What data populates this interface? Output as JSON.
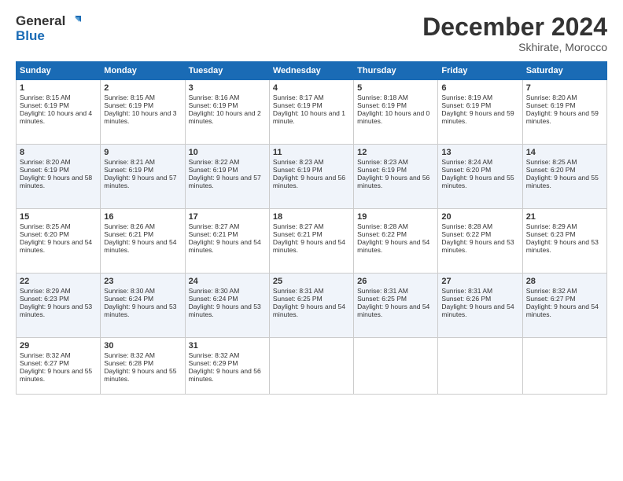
{
  "logo": {
    "line1": "General",
    "line2": "Blue"
  },
  "title": "December 2024",
  "location": "Skhirate, Morocco",
  "days_of_week": [
    "Sunday",
    "Monday",
    "Tuesday",
    "Wednesday",
    "Thursday",
    "Friday",
    "Saturday"
  ],
  "weeks": [
    [
      {
        "day": "1",
        "sunrise": "8:15 AM",
        "sunset": "6:19 PM",
        "daylight": "10 hours and 4 minutes."
      },
      {
        "day": "2",
        "sunrise": "8:15 AM",
        "sunset": "6:19 PM",
        "daylight": "10 hours and 3 minutes."
      },
      {
        "day": "3",
        "sunrise": "8:16 AM",
        "sunset": "6:19 PM",
        "daylight": "10 hours and 2 minutes."
      },
      {
        "day": "4",
        "sunrise": "8:17 AM",
        "sunset": "6:19 PM",
        "daylight": "10 hours and 1 minute."
      },
      {
        "day": "5",
        "sunrise": "8:18 AM",
        "sunset": "6:19 PM",
        "daylight": "10 hours and 0 minutes."
      },
      {
        "day": "6",
        "sunrise": "8:19 AM",
        "sunset": "6:19 PM",
        "daylight": "9 hours and 59 minutes."
      },
      {
        "day": "7",
        "sunrise": "8:20 AM",
        "sunset": "6:19 PM",
        "daylight": "9 hours and 59 minutes."
      }
    ],
    [
      {
        "day": "8",
        "sunrise": "8:20 AM",
        "sunset": "6:19 PM",
        "daylight": "9 hours and 58 minutes."
      },
      {
        "day": "9",
        "sunrise": "8:21 AM",
        "sunset": "6:19 PM",
        "daylight": "9 hours and 57 minutes."
      },
      {
        "day": "10",
        "sunrise": "8:22 AM",
        "sunset": "6:19 PM",
        "daylight": "9 hours and 57 minutes."
      },
      {
        "day": "11",
        "sunrise": "8:23 AM",
        "sunset": "6:19 PM",
        "daylight": "9 hours and 56 minutes."
      },
      {
        "day": "12",
        "sunrise": "8:23 AM",
        "sunset": "6:19 PM",
        "daylight": "9 hours and 56 minutes."
      },
      {
        "day": "13",
        "sunrise": "8:24 AM",
        "sunset": "6:20 PM",
        "daylight": "9 hours and 55 minutes."
      },
      {
        "day": "14",
        "sunrise": "8:25 AM",
        "sunset": "6:20 PM",
        "daylight": "9 hours and 55 minutes."
      }
    ],
    [
      {
        "day": "15",
        "sunrise": "8:25 AM",
        "sunset": "6:20 PM",
        "daylight": "9 hours and 54 minutes."
      },
      {
        "day": "16",
        "sunrise": "8:26 AM",
        "sunset": "6:21 PM",
        "daylight": "9 hours and 54 minutes."
      },
      {
        "day": "17",
        "sunrise": "8:27 AM",
        "sunset": "6:21 PM",
        "daylight": "9 hours and 54 minutes."
      },
      {
        "day": "18",
        "sunrise": "8:27 AM",
        "sunset": "6:21 PM",
        "daylight": "9 hours and 54 minutes."
      },
      {
        "day": "19",
        "sunrise": "8:28 AM",
        "sunset": "6:22 PM",
        "daylight": "9 hours and 54 minutes."
      },
      {
        "day": "20",
        "sunrise": "8:28 AM",
        "sunset": "6:22 PM",
        "daylight": "9 hours and 53 minutes."
      },
      {
        "day": "21",
        "sunrise": "8:29 AM",
        "sunset": "6:23 PM",
        "daylight": "9 hours and 53 minutes."
      }
    ],
    [
      {
        "day": "22",
        "sunrise": "8:29 AM",
        "sunset": "6:23 PM",
        "daylight": "9 hours and 53 minutes."
      },
      {
        "day": "23",
        "sunrise": "8:30 AM",
        "sunset": "6:24 PM",
        "daylight": "9 hours and 53 minutes."
      },
      {
        "day": "24",
        "sunrise": "8:30 AM",
        "sunset": "6:24 PM",
        "daylight": "9 hours and 53 minutes."
      },
      {
        "day": "25",
        "sunrise": "8:31 AM",
        "sunset": "6:25 PM",
        "daylight": "9 hours and 54 minutes."
      },
      {
        "day": "26",
        "sunrise": "8:31 AM",
        "sunset": "6:25 PM",
        "daylight": "9 hours and 54 minutes."
      },
      {
        "day": "27",
        "sunrise": "8:31 AM",
        "sunset": "6:26 PM",
        "daylight": "9 hours and 54 minutes."
      },
      {
        "day": "28",
        "sunrise": "8:32 AM",
        "sunset": "6:27 PM",
        "daylight": "9 hours and 54 minutes."
      }
    ],
    [
      {
        "day": "29",
        "sunrise": "8:32 AM",
        "sunset": "6:27 PM",
        "daylight": "9 hours and 55 minutes."
      },
      {
        "day": "30",
        "sunrise": "8:32 AM",
        "sunset": "6:28 PM",
        "daylight": "9 hours and 55 minutes."
      },
      {
        "day": "31",
        "sunrise": "8:32 AM",
        "sunset": "6:29 PM",
        "daylight": "9 hours and 56 minutes."
      },
      null,
      null,
      null,
      null
    ]
  ]
}
